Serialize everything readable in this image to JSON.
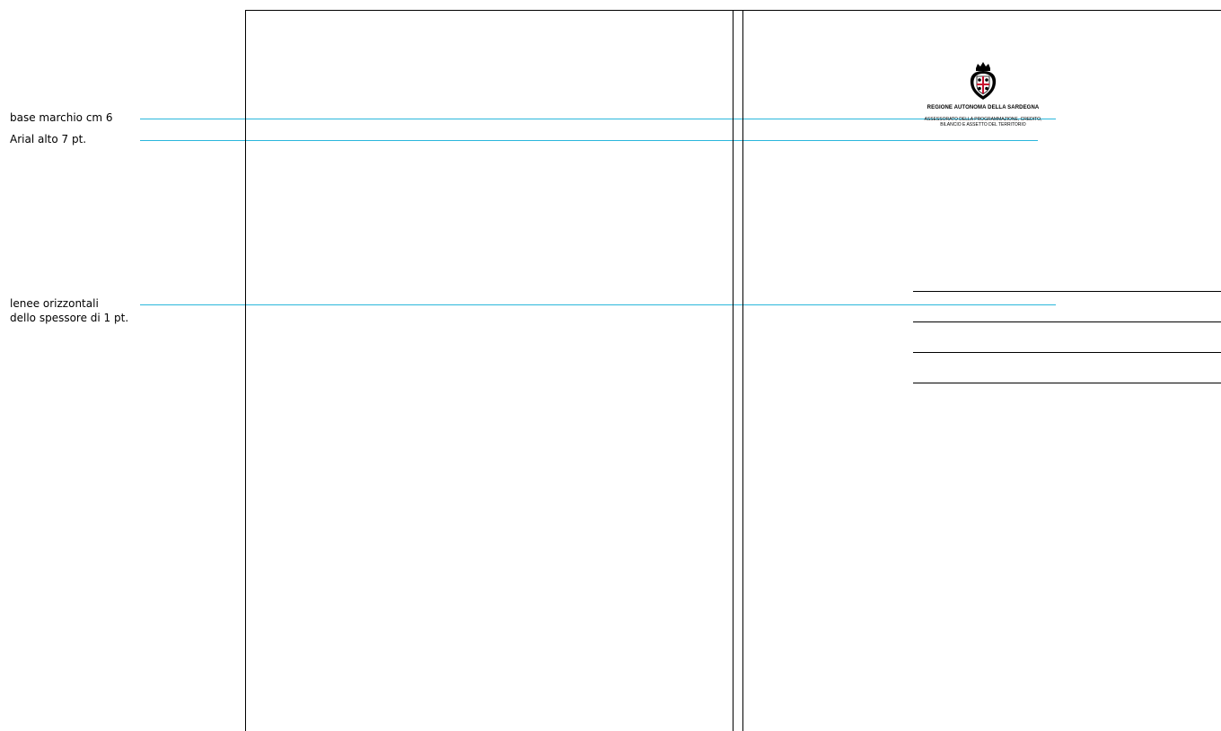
{
  "annotations": {
    "base_marchio": "base marchio cm 6",
    "arial": "Arial alto 7 pt.",
    "linee": [
      "lenee orizzontali",
      "dello spessore di 1 pt."
    ]
  },
  "letterhead": {
    "org_name": "REGIONE AUTONOMA DELLA SARDEGNA",
    "department": [
      "ASSESSORATO DELLA PROGRAMMAZIONE, CREDITO,",
      "BILANCIO E ASSETTO DEL TERRITORIO"
    ],
    "logo_icon": "sardinia-coat-of-arms-icon"
  },
  "colors": {
    "guide": "#2ab7dc",
    "rule": "#000000",
    "coat_red": "#c8102e"
  }
}
